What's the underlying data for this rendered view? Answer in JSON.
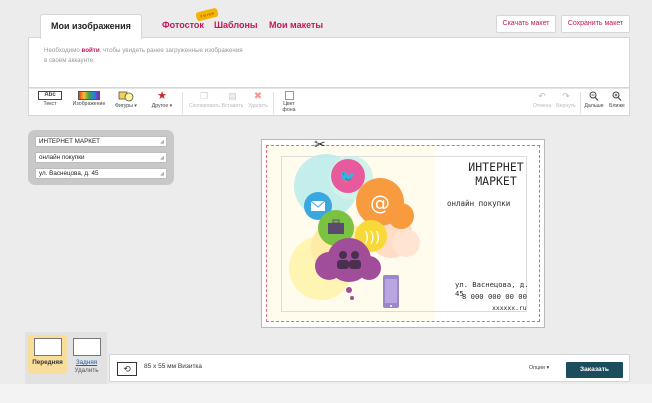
{
  "tabs": [
    {
      "label": "Мои изображения",
      "active": true
    },
    {
      "label": "Фотосток",
      "badge": "it is new"
    },
    {
      "label": "Шаблоны"
    },
    {
      "label": "Мои макеты"
    }
  ],
  "header_buttons": {
    "download": "Скачать макет",
    "save": "Сохранить макет"
  },
  "message": {
    "before": "Необходимо ",
    "login_link": "войти",
    "after": ", чтобы увидеть ранее загруженные изображения в своем аккаунте."
  },
  "toolbar": {
    "text": {
      "icon_text": "Abc",
      "label": "Текст"
    },
    "image": "Изображение",
    "shapes": "Фигуры",
    "other": "Другое",
    "copy": "Скопировать",
    "paste": "Вставить",
    "delete": "Удалить",
    "bg_color": "Цвет фона",
    "undo": "Отмена",
    "redo": "Вернуть",
    "zoom_out": "Дальше",
    "zoom_in": "Ближе"
  },
  "text_fields": [
    "ИНТЕРНЕТ МАРКЕТ",
    "онлайн покупки",
    "ул. Васнецова, д. 45"
  ],
  "card": {
    "title": "ИНТЕРНЕТ МАРКЕТ",
    "subtitle": "онлайн покупки",
    "address": "ул. Васнецова, д. 45",
    "phone": "8 000 000 00 00",
    "site": "xxxxxx.ru"
  },
  "sides": {
    "front": "Передняя",
    "back": "Задняя",
    "delete": "Удалить"
  },
  "bottom": {
    "size": "85 x 55 мм Визитка",
    "options": "Опции",
    "order": "Заказать"
  },
  "colors": {
    "accent": "#c2185b",
    "order": "#1b4d5c",
    "front_tab": "#f9dd9b"
  }
}
